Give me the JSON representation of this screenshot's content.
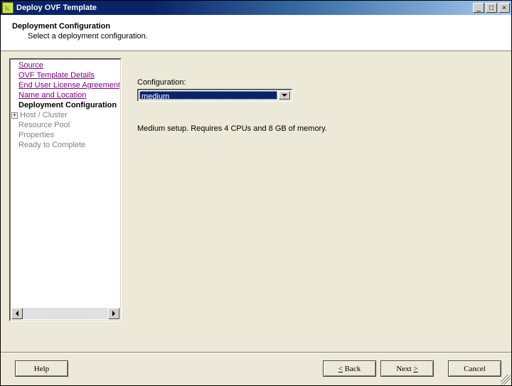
{
  "titlebar": {
    "title": "Deploy OVF Template"
  },
  "header": {
    "title": "Deployment Configuration",
    "subtitle": "Select a deployment configuration."
  },
  "sidebar": {
    "items": [
      {
        "label": "Source",
        "state": "visited"
      },
      {
        "label": "OVF Template Details",
        "state": "visited"
      },
      {
        "label": "End User License Agreement",
        "state": "visited"
      },
      {
        "label": "Name and Location",
        "state": "visited"
      },
      {
        "label": "Deployment Configuration",
        "state": "current"
      },
      {
        "label": "Host / Cluster",
        "state": "disabled",
        "expandable": true
      },
      {
        "label": "Resource Pool",
        "state": "disabled"
      },
      {
        "label": "Properties",
        "state": "disabled"
      },
      {
        "label": "Ready to Complete",
        "state": "disabled"
      }
    ]
  },
  "main": {
    "config_label": "Configuration:",
    "config_value": "medium",
    "config_description": "Medium setup. Requires 4 CPUs and 8 GB of memory."
  },
  "footer": {
    "help": "Help",
    "back": "Back",
    "next": "Next",
    "cancel": "Cancel"
  }
}
